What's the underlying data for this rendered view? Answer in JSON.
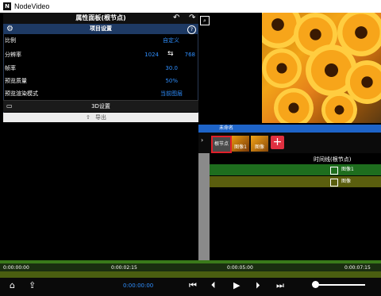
{
  "window": {
    "app_title": "NodeVideo",
    "logo_text": "N"
  },
  "properties": {
    "title": "属性面板(根节点)",
    "undo_icon": "↶",
    "redo_icon": "↷",
    "section_title": "项目设置",
    "help_text": "?",
    "rows": [
      {
        "label": "比例",
        "value": "自定义"
      },
      {
        "label": "分辨率",
        "value_w": "1024",
        "swap": "⇆",
        "value_h": "768"
      },
      {
        "label": "帧率",
        "value": "30.0"
      },
      {
        "label": "预览质量",
        "value": "50%"
      },
      {
        "label": "预览渲染模式",
        "value": "当前图层"
      }
    ],
    "settings_3d": "3D设置",
    "export_label": "导出"
  },
  "timeline": {
    "header_label": "未命名",
    "clips": [
      {
        "label": "根节点"
      },
      {
        "label": "图像1"
      },
      {
        "label": "图像"
      }
    ],
    "add_label": "+",
    "title": "时间线(根节点)",
    "tracks": [
      {
        "label": "图像1",
        "color": "#1e6e1e"
      },
      {
        "label": "图像",
        "color": "#5a5e0e"
      }
    ]
  },
  "ruler": {
    "ticks": [
      "0:00:00:00",
      "0:00:02:15",
      "0:00:05:00",
      "0:00:07:15"
    ]
  },
  "playback": {
    "timecode": "0:00:00:00",
    "home_icon": "⌂",
    "share_icon": "⇪",
    "to_start_icon": "⏮",
    "prev_frame_icon": "⏴",
    "play_icon": "▶",
    "next_frame_icon": "⏵",
    "to_end_icon": "⏭"
  },
  "colors": {
    "accent": "#2f8fff",
    "selection": "#e0202a",
    "timeline_header": "#1e64c8"
  }
}
